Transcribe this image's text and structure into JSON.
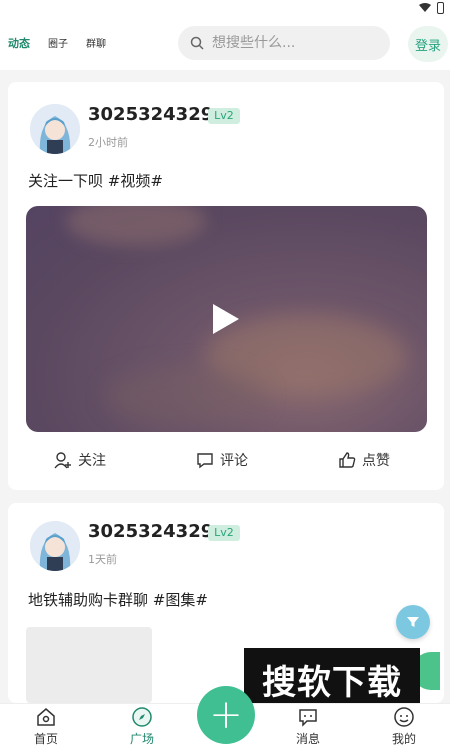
{
  "header": {
    "tabs": [
      "动态",
      "圈子",
      "群聊"
    ],
    "search_placeholder": "想搜些什么...",
    "login_label": "登录"
  },
  "feed": [
    {
      "username": "3025324329",
      "level": "Lv2",
      "time": "2小时前",
      "text": "关注一下呗 #视频#",
      "media": "video",
      "actions": {
        "follow": "关注",
        "comment": "评论",
        "like": "点赞"
      }
    },
    {
      "username": "3025324329",
      "level": "Lv2",
      "time": "1天前",
      "text": "地铁辅助购卡群聊 #图集#",
      "media": "image"
    }
  ],
  "watermark": "搜软下载",
  "bottom_nav": [
    {
      "label": "首页",
      "icon": "home-icon"
    },
    {
      "label": "广场",
      "icon": "compass-icon",
      "active": true
    },
    {
      "label": "",
      "icon": "plus-icon"
    },
    {
      "label": "消息",
      "icon": "message-icon"
    },
    {
      "label": "我的",
      "icon": "profile-icon"
    }
  ],
  "colors": {
    "accent": "#3fbf92",
    "level_bg": "#cfeee0",
    "active_tab": "#1f8a6d"
  }
}
